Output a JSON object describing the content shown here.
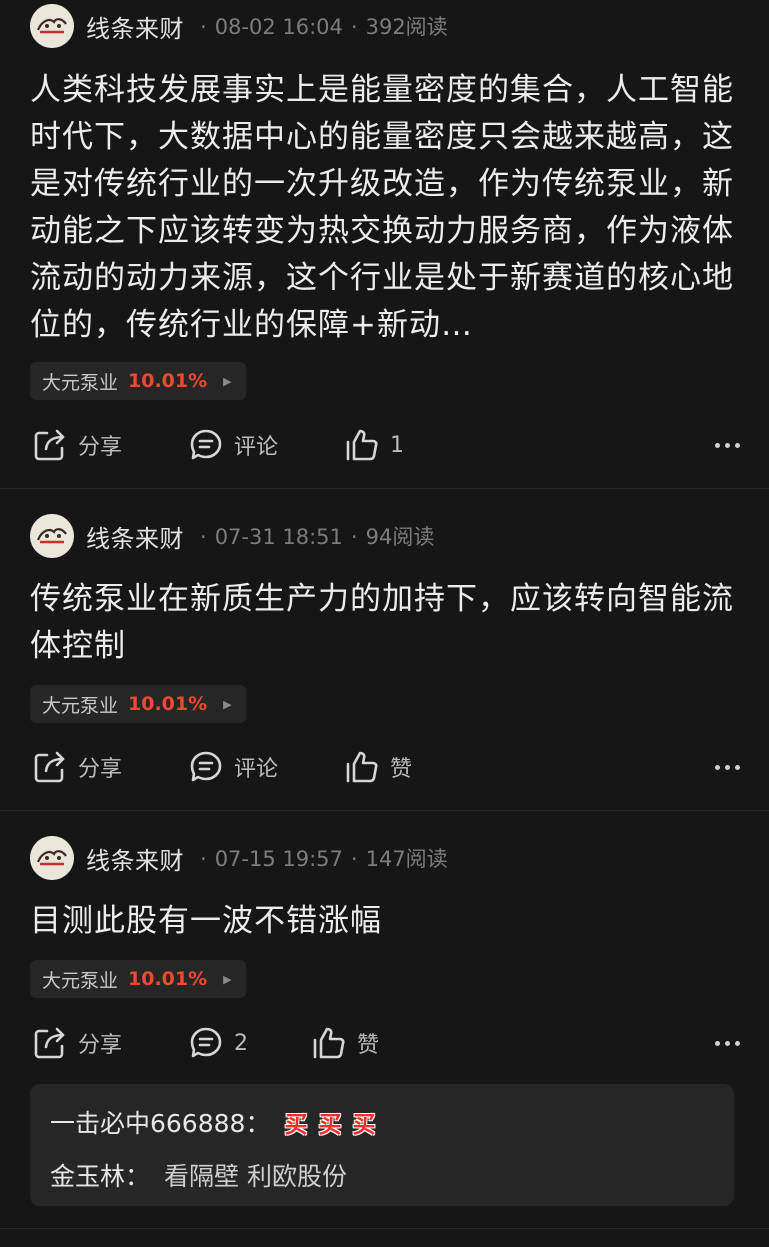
{
  "posts": [
    {
      "username": "线条来财",
      "date": "08-02 16:04",
      "reads": "392阅读",
      "content": "人类科技发展事实上是能量密度的集合，人工智能时代下，大数据中心的能量密度只会越来越高，这是对传统行业的一次升级改造，作为传统泵业，新动能之下应该转变为热交换动力服务商，作为液体流动的动力来源，这个行业是处于新赛道的核心地位的，传统行业的保障+新动…",
      "stock": {
        "name": "大元泵业",
        "change": "10.01%"
      },
      "actions": {
        "share": "分享",
        "comment": "评论",
        "like": "1"
      }
    },
    {
      "username": "线条来财",
      "date": "07-31 18:51",
      "reads": "94阅读",
      "content": "传统泵业在新质生产力的加持下，应该转向智能流体控制",
      "stock": {
        "name": "大元泵业",
        "change": "10.01%"
      },
      "actions": {
        "share": "分享",
        "comment": "评论",
        "like": "赞"
      }
    },
    {
      "username": "线条来财",
      "date": "07-15 19:57",
      "reads": "147阅读",
      "content": "目测此股有一波不错涨幅",
      "stock": {
        "name": "大元泵业",
        "change": "10.01%"
      },
      "actions": {
        "share": "分享",
        "comment": "2",
        "like": "赞"
      },
      "comments": [
        {
          "name": "一击必中666888",
          "colon": "：",
          "emojis": [
            "买",
            "买",
            "买"
          ]
        },
        {
          "name": "金玉林",
          "colon": "：",
          "text": "看隔壁 利欧股份"
        }
      ]
    }
  ],
  "colors": {
    "background": "#161616",
    "card": "#262626",
    "up": "#f0492f",
    "text": "#ececec",
    "muted": "#7c7c7c"
  },
  "icons": [
    "avatar-logo",
    "share-icon",
    "comment-icon",
    "like-icon",
    "more-icon",
    "triangle-right-icon"
  ]
}
